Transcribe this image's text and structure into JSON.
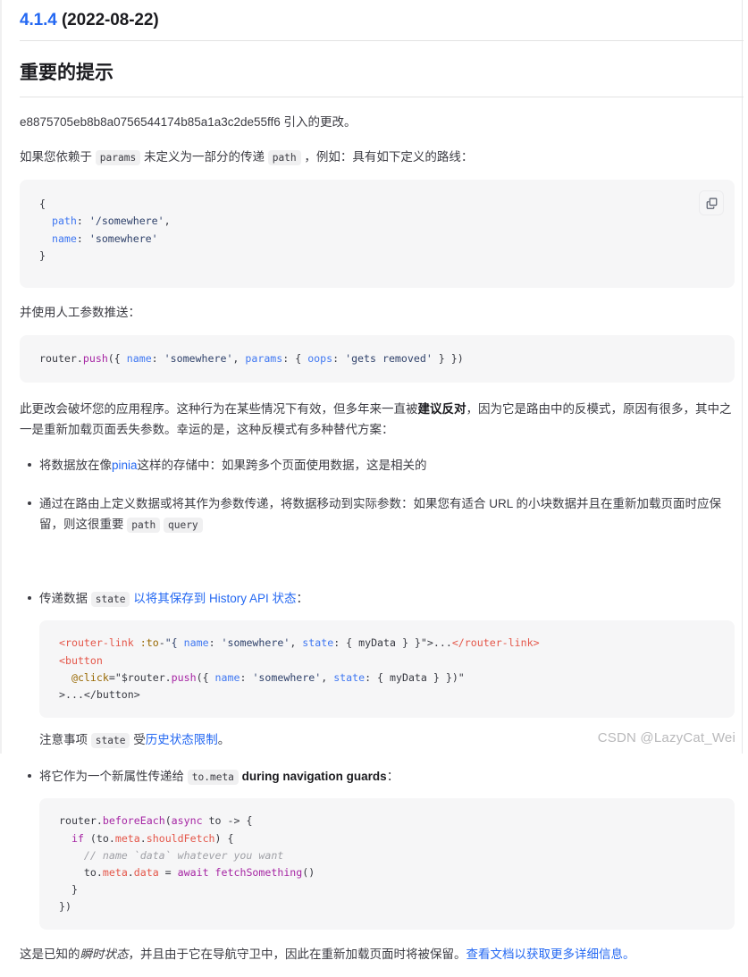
{
  "header": {
    "version": "4.1.4",
    "date": "(2022-08-22)",
    "section_title": "重要的提示"
  },
  "intro": {
    "commit_paragraph": "e8875705eb8b8a0756544174b85a1a3c2de55ff6 引入的更改。",
    "rely_prefix": "如果您依赖于 ",
    "chip_params": "params",
    "rely_mid": " 未定义为一部分的传递 ",
    "chip_path": "path",
    "rely_suffix": " ，例如：具有如下定义的路线："
  },
  "code_route": {
    "line1": "{",
    "line2_key": "path",
    "line2_val": "'/somewhere'",
    "line3_key": "name",
    "line3_val": "'somewhere'",
    "line4": "}",
    "copy_icon": "copy-icon"
  },
  "push_section": {
    "lead": "并使用人工参数推送：",
    "code": {
      "obj": "router",
      "dot": ".",
      "fn": "push",
      "open": "({ ",
      "k1": "name",
      "v1": "'somewhere'",
      "k2": "params",
      "v2": "'gets removed'",
      "k3": "oops",
      "full": "router.push({ name: 'somewhere', params: { oops: 'gets removed' } })"
    }
  },
  "warning_paragraph": {
    "part1": "此更改会破坏您的应用程序。这种行为在某些情况下有效，但多年来一直被",
    "bold": "建议反对",
    "part2": "，因为它是路由中的反模式，原因有很多，其中之一是重新加载页面丢失参数。幸运的是，这种反模式有多种替代方案："
  },
  "bullets": {
    "item1": {
      "pre": "将数据放在像",
      "link": "pinia",
      "post": "这样的存储中：如果跨多个页面使用数据，这是相关的"
    },
    "item2": {
      "text": "通过在路由上定义数据或将其作为参数传递，将数据移动到实际参数：如果您有适合 URL 的小块数据并且在重新加载页面时应保留，则这很重要 ",
      "chip_path": "path",
      "chip_query": "query"
    },
    "item3": {
      "pre": "传递数据 ",
      "chip_state": "state",
      "link": "以将其保存到 History API 状态",
      "post": "：",
      "code_lines": {
        "l1_tag_open": "<router-link",
        "l1_attr": ":to",
        "l1_value": "=\"{ name: 'somewhere', state: { myData } }\">",
        "l1_dots": "...",
        "l1_tag_close": "</router-link>",
        "l2": "<button",
        "l3_attr": "@click",
        "l3_value": "=\"$router.push({ name: 'somewhere', state: { myData } })\"",
        "l4": ">...</button>"
      },
      "note_pre": "注意事项 ",
      "note_chip": "state",
      "note_mid": " 受",
      "note_link": "历史状态限制",
      "note_post": "。"
    },
    "item4": {
      "pre": "将它作为一个新属性传递给 ",
      "chip": "to.meta",
      "post_bold": " during navigation guards",
      "post": "：",
      "code": {
        "l1": "router.beforeEach(async to -> {",
        "l2": "if (to.meta.shouldFetch) {",
        "l3": "// name `data` whatever you want",
        "l4": "to.meta.data = await fetchSomething()",
        "l5": "}",
        "l6": "})"
      }
    }
  },
  "final_paragraph": {
    "pre": "这是已知的",
    "em": "瞬时状态",
    "mid": "，并且由于它在导航守卫中，因此在重新加载页面时将被保留。",
    "link": "查看文档以获取更多详细信息。"
  },
  "watermark": "CSDN @LazyCat_Wei",
  "colors": {
    "link": "#2468f2",
    "code_bg": "#f6f6f7",
    "chip_bg": "#f0f0f1",
    "text": "#3c3c43",
    "heading": "#1b1b1f",
    "rule": "#e2e2e3",
    "watermark": "#b9b9bb"
  }
}
